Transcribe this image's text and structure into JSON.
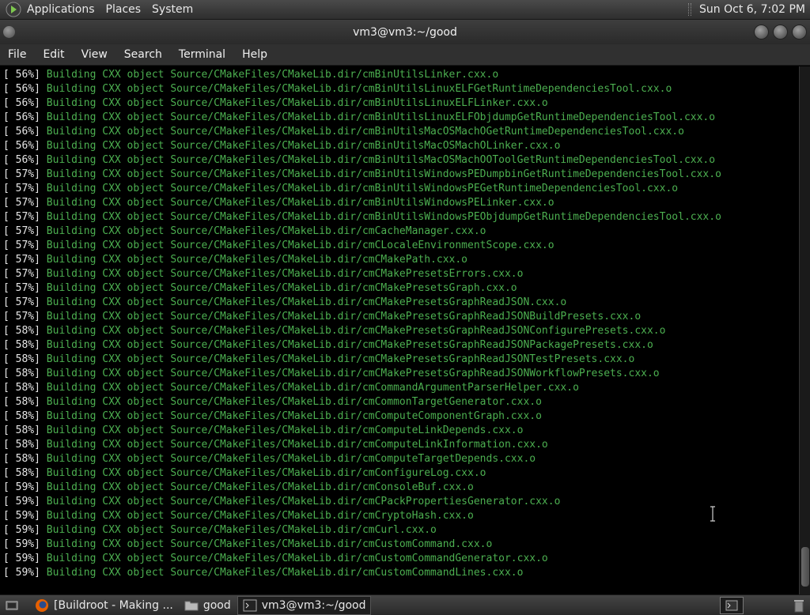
{
  "top_panel": {
    "menus": [
      "Applications",
      "Places",
      "System"
    ],
    "clock": "Sun Oct  6,  7:02 PM"
  },
  "window": {
    "title": "vm3@vm3:~/good"
  },
  "menubar": [
    "File",
    "Edit",
    "View",
    "Search",
    "Terminal",
    "Help"
  ],
  "terminal": {
    "lines": [
      [
        "[ 56%]",
        "Building CXX object Source/CMakeFiles/CMakeLib.dir/cmBinUtilsLinker.cxx.o"
      ],
      [
        "[ 56%]",
        "Building CXX object Source/CMakeFiles/CMakeLib.dir/cmBinUtilsLinuxELFGetRuntimeDependenciesTool.cxx.o"
      ],
      [
        "[ 56%]",
        "Building CXX object Source/CMakeFiles/CMakeLib.dir/cmBinUtilsLinuxELFLinker.cxx.o"
      ],
      [
        "[ 56%]",
        "Building CXX object Source/CMakeFiles/CMakeLib.dir/cmBinUtilsLinuxELFObjdumpGetRuntimeDependenciesTool.cxx.o"
      ],
      [
        "[ 56%]",
        "Building CXX object Source/CMakeFiles/CMakeLib.dir/cmBinUtilsMacOSMachOGetRuntimeDependenciesTool.cxx.o"
      ],
      [
        "[ 56%]",
        "Building CXX object Source/CMakeFiles/CMakeLib.dir/cmBinUtilsMacOSMachOLinker.cxx.o"
      ],
      [
        "[ 56%]",
        "Building CXX object Source/CMakeFiles/CMakeLib.dir/cmBinUtilsMacOSMachOOToolGetRuntimeDependenciesTool.cxx.o"
      ],
      [
        "[ 57%]",
        "Building CXX object Source/CMakeFiles/CMakeLib.dir/cmBinUtilsWindowsPEDumpbinGetRuntimeDependenciesTool.cxx.o"
      ],
      [
        "[ 57%]",
        "Building CXX object Source/CMakeFiles/CMakeLib.dir/cmBinUtilsWindowsPEGetRuntimeDependenciesTool.cxx.o"
      ],
      [
        "[ 57%]",
        "Building CXX object Source/CMakeFiles/CMakeLib.dir/cmBinUtilsWindowsPELinker.cxx.o"
      ],
      [
        "[ 57%]",
        "Building CXX object Source/CMakeFiles/CMakeLib.dir/cmBinUtilsWindowsPEObjdumpGetRuntimeDependenciesTool.cxx.o"
      ],
      [
        "[ 57%]",
        "Building CXX object Source/CMakeFiles/CMakeLib.dir/cmCacheManager.cxx.o"
      ],
      [
        "[ 57%]",
        "Building CXX object Source/CMakeFiles/CMakeLib.dir/cmCLocaleEnvironmentScope.cxx.o"
      ],
      [
        "[ 57%]",
        "Building CXX object Source/CMakeFiles/CMakeLib.dir/cmCMakePath.cxx.o"
      ],
      [
        "[ 57%]",
        "Building CXX object Source/CMakeFiles/CMakeLib.dir/cmCMakePresetsErrors.cxx.o"
      ],
      [
        "[ 57%]",
        "Building CXX object Source/CMakeFiles/CMakeLib.dir/cmCMakePresetsGraph.cxx.o"
      ],
      [
        "[ 57%]",
        "Building CXX object Source/CMakeFiles/CMakeLib.dir/cmCMakePresetsGraphReadJSON.cxx.o"
      ],
      [
        "[ 57%]",
        "Building CXX object Source/CMakeFiles/CMakeLib.dir/cmCMakePresetsGraphReadJSONBuildPresets.cxx.o"
      ],
      [
        "[ 58%]",
        "Building CXX object Source/CMakeFiles/CMakeLib.dir/cmCMakePresetsGraphReadJSONConfigurePresets.cxx.o"
      ],
      [
        "[ 58%]",
        "Building CXX object Source/CMakeFiles/CMakeLib.dir/cmCMakePresetsGraphReadJSONPackagePresets.cxx.o"
      ],
      [
        "[ 58%]",
        "Building CXX object Source/CMakeFiles/CMakeLib.dir/cmCMakePresetsGraphReadJSONTestPresets.cxx.o"
      ],
      [
        "[ 58%]",
        "Building CXX object Source/CMakeFiles/CMakeLib.dir/cmCMakePresetsGraphReadJSONWorkflowPresets.cxx.o"
      ],
      [
        "[ 58%]",
        "Building CXX object Source/CMakeFiles/CMakeLib.dir/cmCommandArgumentParserHelper.cxx.o"
      ],
      [
        "[ 58%]",
        "Building CXX object Source/CMakeFiles/CMakeLib.dir/cmCommonTargetGenerator.cxx.o"
      ],
      [
        "[ 58%]",
        "Building CXX object Source/CMakeFiles/CMakeLib.dir/cmComputeComponentGraph.cxx.o"
      ],
      [
        "[ 58%]",
        "Building CXX object Source/CMakeFiles/CMakeLib.dir/cmComputeLinkDepends.cxx.o"
      ],
      [
        "[ 58%]",
        "Building CXX object Source/CMakeFiles/CMakeLib.dir/cmComputeLinkInformation.cxx.o"
      ],
      [
        "[ 58%]",
        "Building CXX object Source/CMakeFiles/CMakeLib.dir/cmComputeTargetDepends.cxx.o"
      ],
      [
        "[ 58%]",
        "Building CXX object Source/CMakeFiles/CMakeLib.dir/cmConfigureLog.cxx.o"
      ],
      [
        "[ 59%]",
        "Building CXX object Source/CMakeFiles/CMakeLib.dir/cmConsoleBuf.cxx.o"
      ],
      [
        "[ 59%]",
        "Building CXX object Source/CMakeFiles/CMakeLib.dir/cmCPackPropertiesGenerator.cxx.o"
      ],
      [
        "[ 59%]",
        "Building CXX object Source/CMakeFiles/CMakeLib.dir/cmCryptoHash.cxx.o"
      ],
      [
        "[ 59%]",
        "Building CXX object Source/CMakeFiles/CMakeLib.dir/cmCurl.cxx.o"
      ],
      [
        "[ 59%]",
        "Building CXX object Source/CMakeFiles/CMakeLib.dir/cmCustomCommand.cxx.o"
      ],
      [
        "[ 59%]",
        "Building CXX object Source/CMakeFiles/CMakeLib.dir/cmCustomCommandGenerator.cxx.o"
      ],
      [
        "[ 59%]",
        "Building CXX object Source/CMakeFiles/CMakeLib.dir/cmCustomCommandLines.cxx.o"
      ]
    ]
  },
  "taskbar": {
    "tasks": [
      {
        "label": "[Buildroot - Making ...",
        "icon": "firefox-icon"
      },
      {
        "label": "good",
        "icon": "folder-icon"
      },
      {
        "label": "vm3@vm3:~/good",
        "icon": "terminal-icon",
        "active": true
      }
    ]
  },
  "colors": {
    "terminal_text": "#4caf50",
    "percent_text": "#e6e6e6",
    "terminal_bg": "#000000",
    "panel_bg": "#2e2e2e"
  }
}
